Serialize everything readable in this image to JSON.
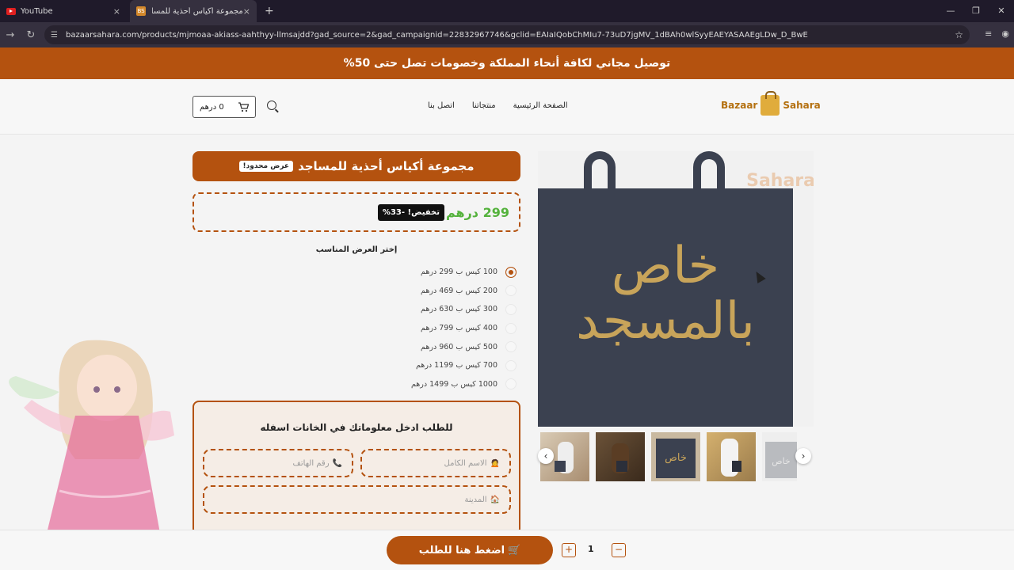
{
  "browser": {
    "tabs": [
      {
        "label": "YouTube",
        "close": "×"
      },
      {
        "label": "مجموعة أكياس أحذية للمساجد",
        "favicon_text": "BS",
        "close": "×"
      }
    ],
    "new_tab": "+",
    "url": "bazaarsahara.com/products/mjmoaa-akiass-aahthyy-llmsajdd?gad_source=2&gad_campaignid=22832967746&gclid=EAIaIQobChMIu7-73uD7jgMV_1dBAh0wlSyyEAEYASAAEgLDw_D_BwE"
  },
  "announcement": "توصيل مجاني لكافة أنحاء المملكة وخصومات تصل حتى 50%",
  "header": {
    "cart_label": "0 درهم",
    "nav": [
      "الصفحة الرئيسية",
      "منتجاتنا",
      "اتصل بنا"
    ],
    "logo_left": "Bazaar",
    "logo_right": "Sahara"
  },
  "product": {
    "title": "مجموعة أكياس أحذية للمساجد",
    "badge": "عرض محدود!",
    "price": "299 درهم",
    "discount": "تخفيض! -33%",
    "image_text": "خاص بالمسجد",
    "watermark": "Sahara",
    "thumb_text": "خاص بالمسجد"
  },
  "offers": {
    "label": "إختر العرض المناسب",
    "items": [
      {
        "text": "100 كيس ب 299 درهم",
        "selected": true
      },
      {
        "text": "200 كيس ب 469 درهم",
        "selected": false
      },
      {
        "text": "300 كيس ب 630 درهم",
        "selected": false
      },
      {
        "text": "400 كيس ب 799 درهم",
        "selected": false
      },
      {
        "text": "500 كيس ب 960 درهم",
        "selected": false
      },
      {
        "text": "700 كيس ب 1199 درهم",
        "selected": false
      },
      {
        "text": "1000 كيس ب 1499 درهم",
        "selected": false
      }
    ]
  },
  "form": {
    "title": "للطلب ادخل معلوماتك في الخانات اسفله",
    "name_placeholder": "الاسم الكامل",
    "phone_placeholder": "رقم الهاتف",
    "city_placeholder": "المدينة"
  },
  "bottom": {
    "order_button": "اضغط هنا للطلب",
    "quantity": "1",
    "plus": "+",
    "minus": "−"
  },
  "colors": {
    "accent": "#b4520f",
    "price_green": "#54b23c",
    "bag_navy": "#3b4150",
    "bag_gold": "#c8a45a"
  }
}
